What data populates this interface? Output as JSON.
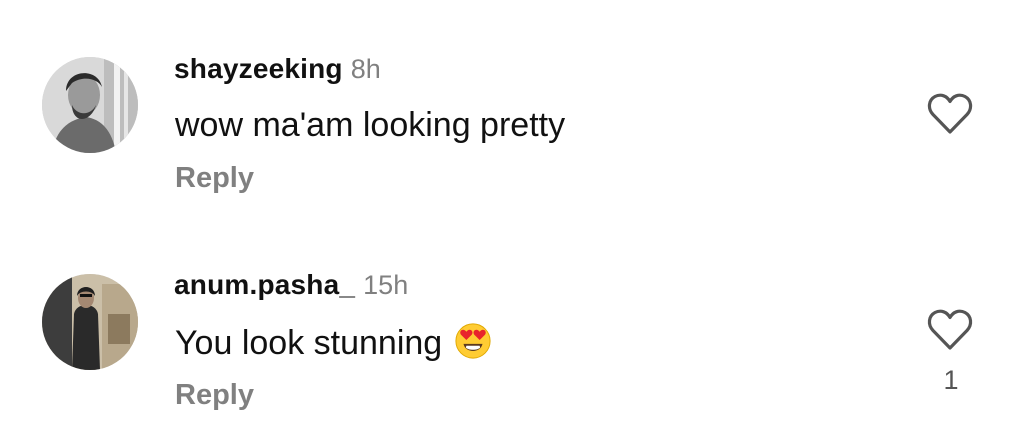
{
  "colors": {
    "text": "#111111",
    "muted": "#808080",
    "background": "#ffffff"
  },
  "comments": [
    {
      "username": "shayzeeking",
      "time": "8h",
      "text": "wow ma'am looking pretty",
      "emoji": "",
      "reply_label": "Reply",
      "like_count": "",
      "avatar_icon": "user-avatar-photo",
      "like_icon": "heart-outline-icon"
    },
    {
      "username": "anum.pasha_",
      "time": "15h",
      "text": "You look stunning",
      "emoji": "heart-eyes-emoji",
      "reply_label": "Reply",
      "like_count": "1",
      "avatar_icon": "user-avatar-photo",
      "like_icon": "heart-outline-icon"
    }
  ]
}
